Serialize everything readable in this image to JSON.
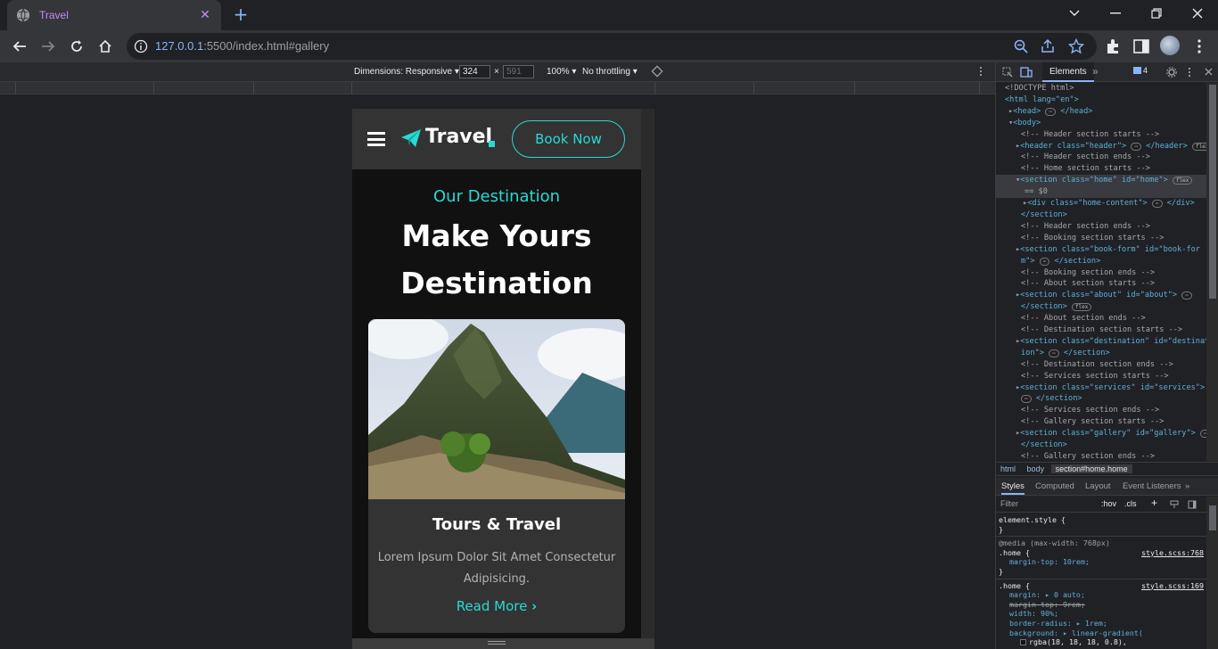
{
  "browser": {
    "tab_title": "Travel",
    "url_host": "127.0.0.1",
    "url_rest": ":5500/index.html#gallery"
  },
  "device_toolbar": {
    "dimensions_label": "Dimensions: Responsive",
    "width": "324",
    "height": "591",
    "times": "×",
    "zoom": "100%",
    "throttling": "No throttling"
  },
  "site": {
    "logo": "Travel",
    "book_button": "Book Now",
    "home_subtitle": "Our Destination",
    "home_title_line1": "Make Yours",
    "home_title_line2": "Destination",
    "card": {
      "title": "Tours & Travel",
      "text": "Lorem Ipsum Dolor Sit Amet Consectetur Adipisicing.",
      "link": "Read More",
      "link_arrow": "›"
    }
  },
  "devtools": {
    "active_tab": "Elements",
    "issues_count": "4",
    "dom_lines": [
      "<!DOCTYPE html>",
      "<html lang=\"en\">",
      "<head>",
      "<body>",
      "<!-- Header section starts -->",
      "<header class=\"header\">",
      "<!-- Header section ends -->",
      "<!-- Home section starts -->",
      "<section class=\"home\" id=\"home\">",
      "== $0",
      "<div class=\"home-content\">",
      "</section>",
      "<!-- Header section ends -->",
      "<!-- Booking section starts -->",
      "<section class=\"book-form\" id=\"book-for",
      "m\">",
      "<!-- Booking section ends -->",
      "<!-- About section starts -->",
      "<section class=\"about\" id=\"about\">",
      "</section>",
      "<!-- About section ends -->",
      "<!-- Destination section starts -->",
      "<section class=\"destination\" id=\"destinat",
      "ion\">",
      "<!-- Destination section ends -->",
      "<!-- Services section starts -->",
      "<section class=\"services\" id=\"services\">",
      "</section>",
      "<!-- Services section ends -->",
      "<!-- Gallery section starts -->",
      "<section class=\"gallery\" id=\"gallery\">",
      "</section>",
      "<!-- Gallery section ends -->"
    ],
    "breadcrumbs": [
      "html",
      "body",
      "section#home.home"
    ],
    "sub_tabs": [
      "Styles",
      "Computed",
      "Layout",
      "Event Listeners"
    ],
    "filter_placeholder": "Filter",
    "hov": ":hov",
    "cls": ".cls",
    "styles": {
      "element_style": "element.style {",
      "close_brace": "}",
      "media": "@media (max-width: 768px)",
      "home_selector": ".home {",
      "src1": "style.scss:768",
      "src2": "style.scss:169",
      "p_margin_top": "margin-top: 10rem;",
      "p_margin": "margin: ▸ 0 auto;",
      "p_margin_top_struck": "margin-top: 9rem;",
      "p_width": "width: 90%;",
      "p_radius": "border-radius: ▸ 1rem;",
      "p_background": "background: ▸ linear-gradient(",
      "p_rgba": "rgba(18, 18, 18, 0.8),"
    }
  }
}
